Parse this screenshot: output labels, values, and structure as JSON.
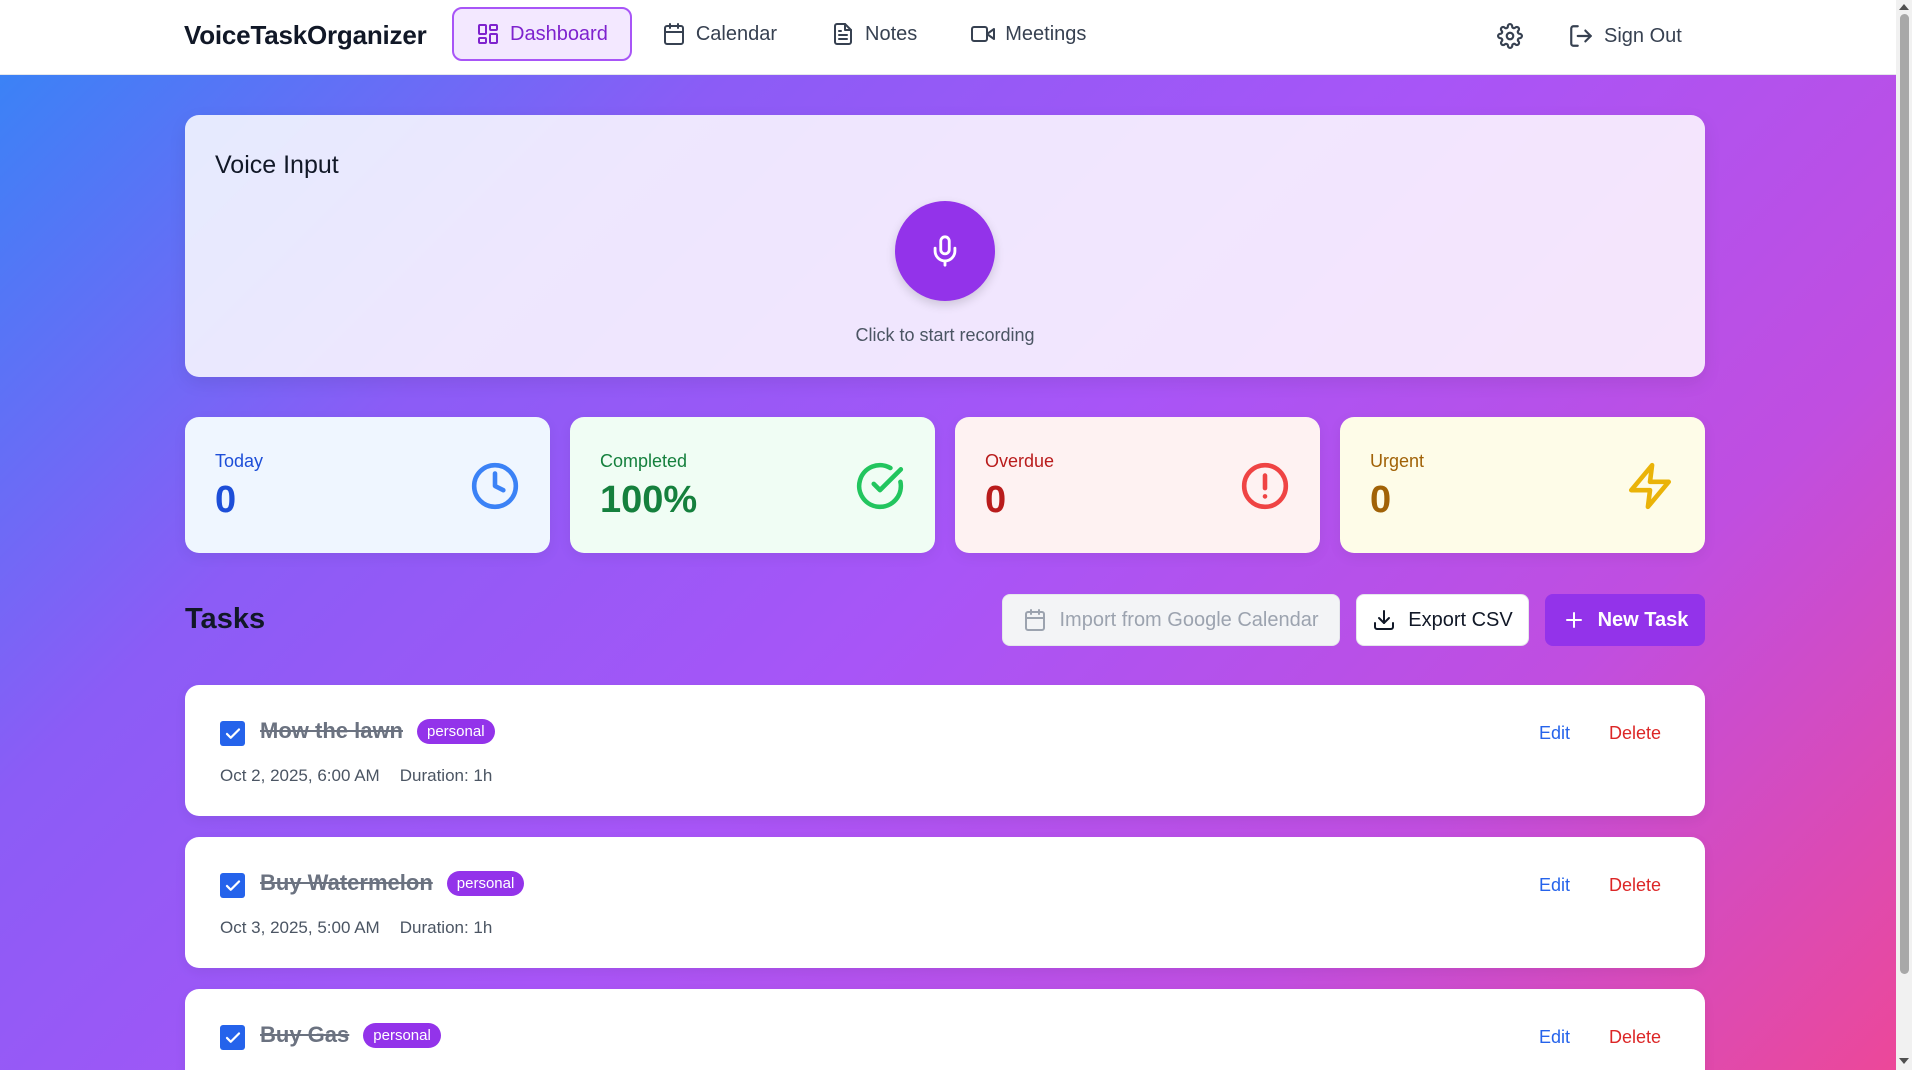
{
  "app": {
    "title": "VoiceTaskOrganizer"
  },
  "nav": {
    "items": [
      {
        "label": "Dashboard",
        "icon": "dashboard-icon",
        "active": true
      },
      {
        "label": "Calendar",
        "icon": "calendar-icon",
        "active": false
      },
      {
        "label": "Notes",
        "icon": "notes-icon",
        "active": false
      },
      {
        "label": "Meetings",
        "icon": "video-icon",
        "active": false
      }
    ],
    "settings_icon": "gear-icon",
    "signout_label": "Sign Out"
  },
  "voice": {
    "title": "Voice Input",
    "hint": "Click to start recording"
  },
  "stats": {
    "today": {
      "label": "Today",
      "value": "0"
    },
    "completed": {
      "label": "Completed",
      "value": "100%"
    },
    "overdue": {
      "label": "Overdue",
      "value": "0"
    },
    "urgent": {
      "label": "Urgent",
      "value": "0"
    }
  },
  "tasks": {
    "heading": "Tasks",
    "import_label": "Import from Google Calendar",
    "export_label": "Export CSV",
    "new_label": "New Task",
    "edit_label": "Edit",
    "delete_label": "Delete",
    "items": [
      {
        "title": "Mow the lawn",
        "tag": "personal",
        "date": "Oct 2, 2025, 6:00 AM",
        "duration": "Duration: 1h",
        "done": true
      },
      {
        "title": "Buy Watermelon",
        "tag": "personal",
        "date": "Oct 3, 2025, 5:00 AM",
        "duration": "Duration: 1h",
        "done": true
      },
      {
        "title": "Buy Gas",
        "tag": "personal",
        "date": "",
        "duration": "",
        "done": true
      }
    ]
  },
  "colors": {
    "accent": "#9333ea",
    "gradient_start": "#3b82f6",
    "gradient_end": "#ec4899"
  }
}
